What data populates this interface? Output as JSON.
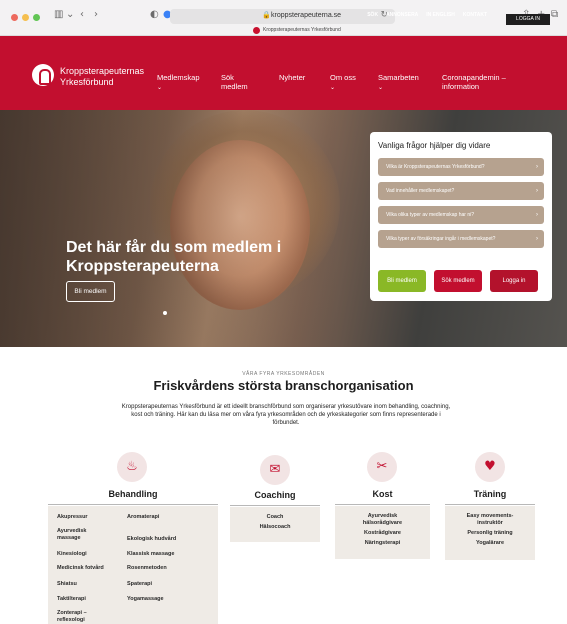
{
  "browser": {
    "url": "kroppsterapeuterna.se",
    "tab_title": "Kroppsterapeuternas Yrkesförbund",
    "icons": [
      "sidebar-icon",
      "back-icon",
      "forward-icon",
      "shield-icon",
      "reload-icon",
      "share-icon",
      "new-tab-icon",
      "tabs-icon"
    ]
  },
  "header": {
    "top_links": [
      "SÖK",
      "ANNONSERA",
      "IN ENGLISH",
      "KONTAKT"
    ],
    "login_label": "LOGGA IN",
    "brand_line1": "Kroppsterapeuternas",
    "brand_line2": "Yrkesförbund",
    "nav": [
      {
        "line1": "Medlemskap",
        "line2": ""
      },
      {
        "line1": "Sök",
        "line2": "medlem"
      },
      {
        "line1": "Nyheter",
        "line2": ""
      },
      {
        "line1": "Om oss",
        "line2": ""
      },
      {
        "line1": "Samarbeten",
        "line2": ""
      },
      {
        "line1": "Coronapandemin –",
        "line2": "information"
      }
    ],
    "colors": {
      "brand_red": "#c20f2f"
    }
  },
  "hero": {
    "title": "Det här får du som medlem i Kroppsterapeuterna",
    "button": "Bli medlem"
  },
  "faq": {
    "title": "Vanliga frågor hjälper dig vidare",
    "questions": [
      "Vilka är Kroppsterapeuternas Yrkesförbund?",
      "Vad innehåller medlemskapet?",
      "Vilka olika typer av medlemskap har ni?",
      "Vilka typer av försäkringar ingår i medlemskapet?"
    ],
    "buttons": [
      "Bli medlem",
      "Sök medlem",
      "Logga in"
    ]
  },
  "content": {
    "kicker": "VÅRA FYRA YRKESOMRÅDEN",
    "title": "Friskvårdens största branschorganisation",
    "intro": "Kroppsterapeuternas Yrkesförbund är ett ideellt branschförbund som organiserar yrkesutövare inom behandling, coachning, kost och träning. Här kan du läsa mer om våra fyra yrkesområden och de yrkeskategorier som finns representerade i förbundet."
  },
  "categories": [
    {
      "title": "Behandling",
      "icon": "massage-icon",
      "col1": [
        "Akupressur",
        "Ayurvedisk massage",
        "Kinesiologi",
        "Medicinsk fotvård",
        "Shiatsu",
        "Taktilterapi",
        "Zonterapi – reflexologi"
      ],
      "col2": [
        "Aromaterapi",
        "Ekologisk hudvård",
        "Klassisk massage",
        "Rosenmetoden",
        "Spaterapi",
        "Yogamassage"
      ]
    },
    {
      "title": "Coaching",
      "icon": "chat-icon",
      "items": [
        "Coach",
        "Hälsocoach"
      ]
    },
    {
      "title": "Kost",
      "icon": "nutrition-icon",
      "items": [
        "Ayurvedisk hälsorådgivare",
        "Kostrådgivare",
        "Näringsterapi"
      ]
    },
    {
      "title": "Träning",
      "icon": "heartbeat-icon",
      "items": [
        "Easy movements-instruktör",
        "Personlig träning",
        "Yogalärare"
      ]
    }
  ]
}
